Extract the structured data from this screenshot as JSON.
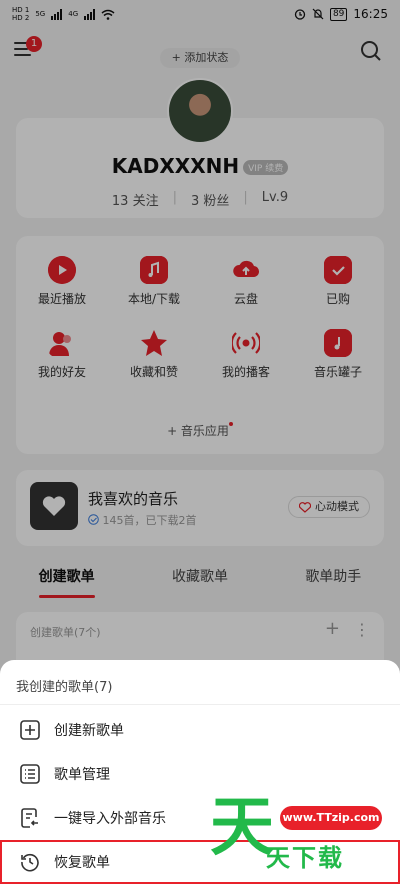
{
  "status_bar": {
    "time": "16:25",
    "battery": "89",
    "sim1": "HD 1",
    "sim2": "HD 2",
    "net1": "5G",
    "net2": "4G"
  },
  "header": {
    "notification_count": "1",
    "add_status_label": "+ 添加状态"
  },
  "profile": {
    "username": "KADXXXNH",
    "vip_badge": "VIP 续费",
    "following": "13 关注",
    "fans": "3 粉丝",
    "level": "Lv.9"
  },
  "shortcuts": {
    "items": [
      {
        "label": "最近播放",
        "icon": "play-icon"
      },
      {
        "label": "本地/下载",
        "icon": "music-file-icon"
      },
      {
        "label": "云盘",
        "icon": "cloud-upload-icon"
      },
      {
        "label": "已购",
        "icon": "bag-check-icon"
      },
      {
        "label": "我的好友",
        "icon": "friends-icon"
      },
      {
        "label": "收藏和赞",
        "icon": "star-icon"
      },
      {
        "label": "我的播客",
        "icon": "radio-icon"
      },
      {
        "label": "音乐罐子",
        "icon": "jar-icon"
      }
    ],
    "music_apps_label": "+ 音乐应用"
  },
  "liked": {
    "title": "我喜欢的音乐",
    "subtitle": "145首，已下载2首",
    "heart_mode_label": "心动模式"
  },
  "tabs": [
    {
      "label": "创建歌单",
      "active": true
    },
    {
      "label": "收藏歌单",
      "active": false
    },
    {
      "label": "歌单助手",
      "active": false
    }
  ],
  "created_list": {
    "header": "创建歌单(7个)"
  },
  "sheet": {
    "title": "我创建的歌单(7)",
    "items": [
      {
        "label": "创建新歌单",
        "icon": "plus-square-icon"
      },
      {
        "label": "歌单管理",
        "icon": "list-icon"
      },
      {
        "label": "一键导入外部音乐",
        "icon": "import-icon"
      },
      {
        "label": "恢复歌单",
        "icon": "history-icon"
      }
    ]
  },
  "watermark": {
    "url": "www.TTzip.com",
    "tian": "天",
    "text": "天下载"
  },
  "colors": {
    "accent": "#e8212a",
    "watermark_green": "#22b94a"
  }
}
